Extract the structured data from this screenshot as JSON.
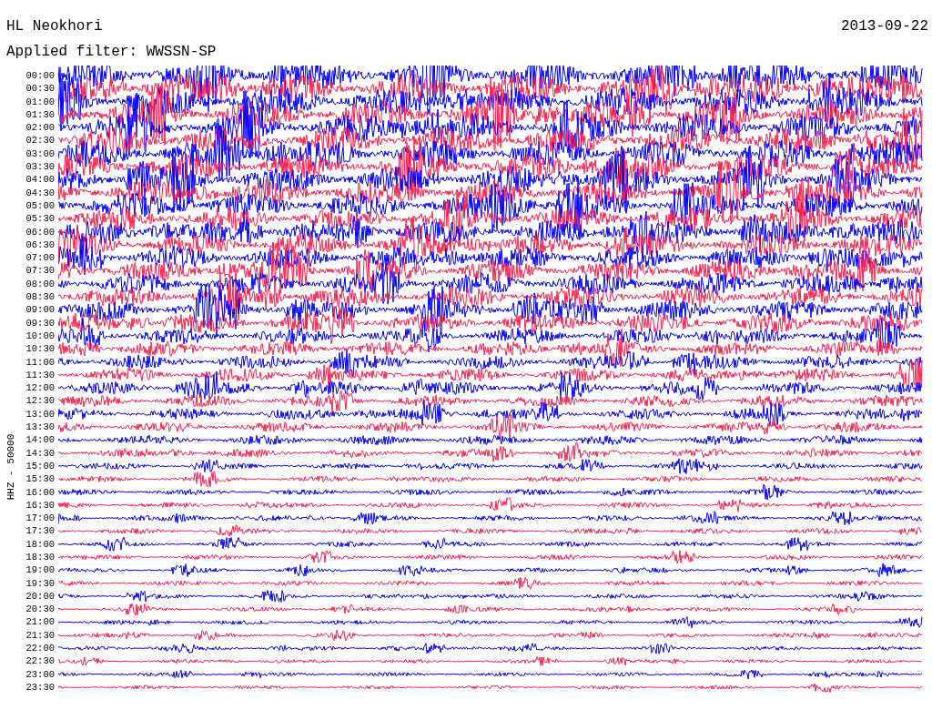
{
  "station": "HL Neokhori",
  "date": "2013-09-22",
  "filter": "Applied filter: WWSSN-SP",
  "channel": "HHZ - 50000",
  "rows": [
    {
      "time": "00:00",
      "color": "#0000ff"
    },
    {
      "time": "00:30",
      "color": "#ff1f4b"
    },
    {
      "time": "01:00",
      "color": "#0000ff"
    },
    {
      "time": "01:30",
      "color": "#ff1f4b"
    },
    {
      "time": "02:00",
      "color": "#0000ff"
    },
    {
      "time": "02:30",
      "color": "#ff1f4b"
    },
    {
      "time": "03:00",
      "color": "#0000ff"
    },
    {
      "time": "03:30",
      "color": "#ff1f4b"
    },
    {
      "time": "04:00",
      "color": "#0000ff"
    },
    {
      "time": "04:30",
      "color": "#ff1f4b"
    },
    {
      "time": "05:00",
      "color": "#0000ff"
    },
    {
      "time": "05:30",
      "color": "#ff1f4b"
    },
    {
      "time": "06:00",
      "color": "#0000ff"
    },
    {
      "time": "06:30",
      "color": "#ff1f4b"
    },
    {
      "time": "07:00",
      "color": "#0000ff"
    },
    {
      "time": "07:30",
      "color": "#ff1f4b"
    },
    {
      "time": "08:00",
      "color": "#0000ff"
    },
    {
      "time": "08:30",
      "color": "#ff1f4b"
    },
    {
      "time": "09:00",
      "color": "#0000ff"
    },
    {
      "time": "09:30",
      "color": "#ff1f4b"
    },
    {
      "time": "10:00",
      "color": "#0000ff"
    },
    {
      "time": "10:30",
      "color": "#ff1f4b"
    },
    {
      "time": "11:00",
      "color": "#0000ff"
    },
    {
      "time": "11:30",
      "color": "#ff1f4b"
    },
    {
      "time": "12:00",
      "color": "#0000ff"
    },
    {
      "time": "12:30",
      "color": "#ff1f4b"
    },
    {
      "time": "13:00",
      "color": "#0000ff"
    },
    {
      "time": "13:30",
      "color": "#ff1f4b"
    },
    {
      "time": "14:00",
      "color": "#0000ff"
    },
    {
      "time": "14:30",
      "color": "#ff1f4b"
    },
    {
      "time": "15:00",
      "color": "#0000ff"
    },
    {
      "time": "15:30",
      "color": "#ff1f4b"
    },
    {
      "time": "16:00",
      "color": "#0000ff"
    },
    {
      "time": "16:30",
      "color": "#ff1f4b"
    },
    {
      "time": "17:00",
      "color": "#0000ff"
    },
    {
      "time": "17:30",
      "color": "#ff1f4b"
    },
    {
      "time": "18:00",
      "color": "#0000ff"
    },
    {
      "time": "18:30",
      "color": "#ff1f4b"
    },
    {
      "time": "19:00",
      "color": "#0000ff"
    },
    {
      "time": "19:30",
      "color": "#ff1f4b"
    },
    {
      "time": "20:00",
      "color": "#0000ff"
    },
    {
      "time": "20:30",
      "color": "#ff1f4b"
    },
    {
      "time": "21:00",
      "color": "#0000ff"
    },
    {
      "time": "21:30",
      "color": "#ff1f4b"
    },
    {
      "time": "22:00",
      "color": "#0000ff"
    },
    {
      "time": "22:30",
      "color": "#ff1f4b"
    },
    {
      "time": "23:00",
      "color": "#0000ff"
    },
    {
      "time": "23:30",
      "color": "#ff1f4b"
    }
  ]
}
